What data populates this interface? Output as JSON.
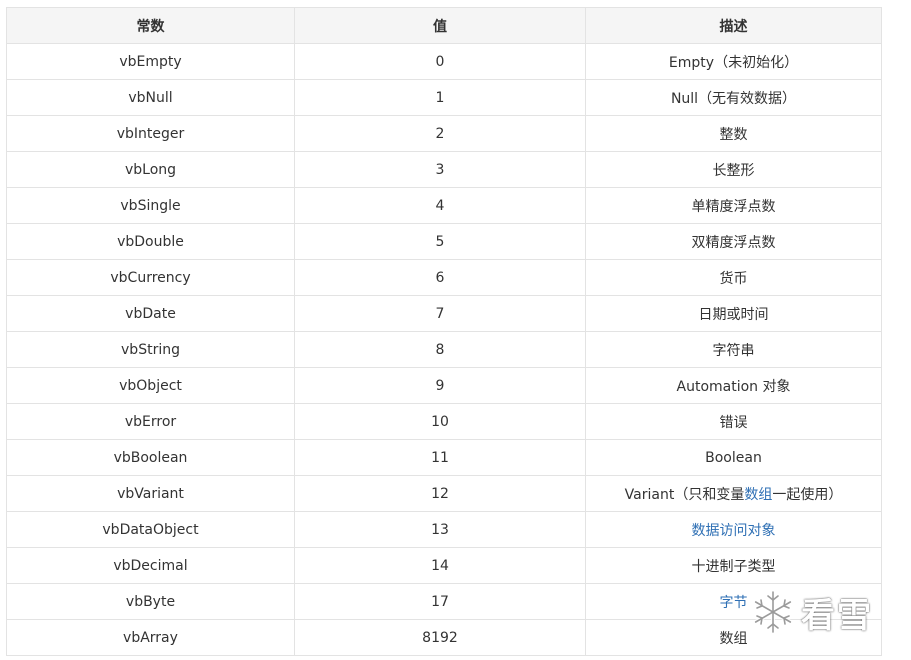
{
  "table": {
    "headers": [
      "常数",
      "值",
      "描述"
    ],
    "rows": [
      {
        "c": "vbEmpty",
        "v": "0",
        "d": [
          {
            "t": "Empty（未初始化）"
          }
        ]
      },
      {
        "c": "vbNull",
        "v": "1",
        "d": [
          {
            "t": "Null（无有效数据）"
          }
        ]
      },
      {
        "c": "vbInteger",
        "v": "2",
        "d": [
          {
            "t": "整数"
          }
        ]
      },
      {
        "c": "vbLong",
        "v": "3",
        "d": [
          {
            "t": "长整形"
          }
        ]
      },
      {
        "c": "vbSingle",
        "v": "4",
        "d": [
          {
            "t": "单精度浮点数"
          }
        ]
      },
      {
        "c": "vbDouble",
        "v": "5",
        "d": [
          {
            "t": "双精度浮点数"
          }
        ]
      },
      {
        "c": "vbCurrency",
        "v": "6",
        "d": [
          {
            "t": "货币"
          }
        ]
      },
      {
        "c": "vbDate",
        "v": "7",
        "d": [
          {
            "t": "日期或时间"
          }
        ]
      },
      {
        "c": "vbString",
        "v": "8",
        "d": [
          {
            "t": "字符串"
          }
        ]
      },
      {
        "c": "vbObject",
        "v": "9",
        "d": [
          {
            "t": "Automation 对象"
          }
        ]
      },
      {
        "c": "vbError",
        "v": "10",
        "d": [
          {
            "t": "错误"
          }
        ]
      },
      {
        "c": "vbBoolean",
        "v": "11",
        "d": [
          {
            "t": "Boolean"
          }
        ]
      },
      {
        "c": "vbVariant",
        "v": "12",
        "d": [
          {
            "t": "Variant（只和变量"
          },
          {
            "t": "数组",
            "link": true
          },
          {
            "t": "一起使用）"
          }
        ]
      },
      {
        "c": "vbDataObject",
        "v": "13",
        "d": [
          {
            "t": "数据访问对象",
            "link": true
          }
        ]
      },
      {
        "c": "vbDecimal",
        "v": "14",
        "d": [
          {
            "t": "十进制子类型"
          }
        ]
      },
      {
        "c": "vbByte",
        "v": "17",
        "d": [
          {
            "t": "字节",
            "link": true
          }
        ]
      },
      {
        "c": "vbArray",
        "v": "8192",
        "d": [
          {
            "t": "数组"
          }
        ]
      }
    ]
  },
  "colors": {
    "link": "#2e6fb4",
    "text": "#333333",
    "header_bg": "#f5f5f5",
    "border": "#e3e3e3"
  },
  "watermark": {
    "icon": "snowflake-icon",
    "text": "看雪"
  }
}
